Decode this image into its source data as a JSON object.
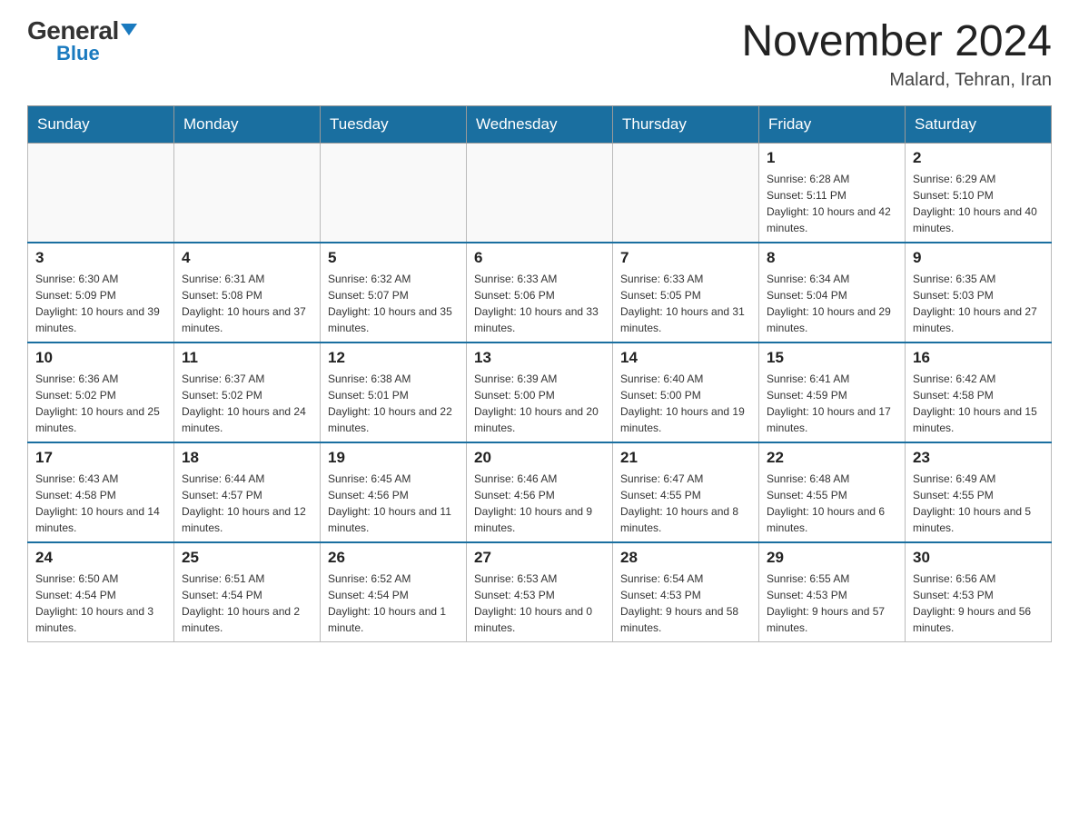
{
  "header": {
    "logo_general": "General",
    "logo_blue": "Blue",
    "month_title": "November 2024",
    "location": "Malard, Tehran, Iran"
  },
  "weekdays": [
    "Sunday",
    "Monday",
    "Tuesday",
    "Wednesday",
    "Thursday",
    "Friday",
    "Saturday"
  ],
  "weeks": [
    [
      {
        "day": "",
        "info": ""
      },
      {
        "day": "",
        "info": ""
      },
      {
        "day": "",
        "info": ""
      },
      {
        "day": "",
        "info": ""
      },
      {
        "day": "",
        "info": ""
      },
      {
        "day": "1",
        "info": "Sunrise: 6:28 AM\nSunset: 5:11 PM\nDaylight: 10 hours and 42 minutes."
      },
      {
        "day": "2",
        "info": "Sunrise: 6:29 AM\nSunset: 5:10 PM\nDaylight: 10 hours and 40 minutes."
      }
    ],
    [
      {
        "day": "3",
        "info": "Sunrise: 6:30 AM\nSunset: 5:09 PM\nDaylight: 10 hours and 39 minutes."
      },
      {
        "day": "4",
        "info": "Sunrise: 6:31 AM\nSunset: 5:08 PM\nDaylight: 10 hours and 37 minutes."
      },
      {
        "day": "5",
        "info": "Sunrise: 6:32 AM\nSunset: 5:07 PM\nDaylight: 10 hours and 35 minutes."
      },
      {
        "day": "6",
        "info": "Sunrise: 6:33 AM\nSunset: 5:06 PM\nDaylight: 10 hours and 33 minutes."
      },
      {
        "day": "7",
        "info": "Sunrise: 6:33 AM\nSunset: 5:05 PM\nDaylight: 10 hours and 31 minutes."
      },
      {
        "day": "8",
        "info": "Sunrise: 6:34 AM\nSunset: 5:04 PM\nDaylight: 10 hours and 29 minutes."
      },
      {
        "day": "9",
        "info": "Sunrise: 6:35 AM\nSunset: 5:03 PM\nDaylight: 10 hours and 27 minutes."
      }
    ],
    [
      {
        "day": "10",
        "info": "Sunrise: 6:36 AM\nSunset: 5:02 PM\nDaylight: 10 hours and 25 minutes."
      },
      {
        "day": "11",
        "info": "Sunrise: 6:37 AM\nSunset: 5:02 PM\nDaylight: 10 hours and 24 minutes."
      },
      {
        "day": "12",
        "info": "Sunrise: 6:38 AM\nSunset: 5:01 PM\nDaylight: 10 hours and 22 minutes."
      },
      {
        "day": "13",
        "info": "Sunrise: 6:39 AM\nSunset: 5:00 PM\nDaylight: 10 hours and 20 minutes."
      },
      {
        "day": "14",
        "info": "Sunrise: 6:40 AM\nSunset: 5:00 PM\nDaylight: 10 hours and 19 minutes."
      },
      {
        "day": "15",
        "info": "Sunrise: 6:41 AM\nSunset: 4:59 PM\nDaylight: 10 hours and 17 minutes."
      },
      {
        "day": "16",
        "info": "Sunrise: 6:42 AM\nSunset: 4:58 PM\nDaylight: 10 hours and 15 minutes."
      }
    ],
    [
      {
        "day": "17",
        "info": "Sunrise: 6:43 AM\nSunset: 4:58 PM\nDaylight: 10 hours and 14 minutes."
      },
      {
        "day": "18",
        "info": "Sunrise: 6:44 AM\nSunset: 4:57 PM\nDaylight: 10 hours and 12 minutes."
      },
      {
        "day": "19",
        "info": "Sunrise: 6:45 AM\nSunset: 4:56 PM\nDaylight: 10 hours and 11 minutes."
      },
      {
        "day": "20",
        "info": "Sunrise: 6:46 AM\nSunset: 4:56 PM\nDaylight: 10 hours and 9 minutes."
      },
      {
        "day": "21",
        "info": "Sunrise: 6:47 AM\nSunset: 4:55 PM\nDaylight: 10 hours and 8 minutes."
      },
      {
        "day": "22",
        "info": "Sunrise: 6:48 AM\nSunset: 4:55 PM\nDaylight: 10 hours and 6 minutes."
      },
      {
        "day": "23",
        "info": "Sunrise: 6:49 AM\nSunset: 4:55 PM\nDaylight: 10 hours and 5 minutes."
      }
    ],
    [
      {
        "day": "24",
        "info": "Sunrise: 6:50 AM\nSunset: 4:54 PM\nDaylight: 10 hours and 3 minutes."
      },
      {
        "day": "25",
        "info": "Sunrise: 6:51 AM\nSunset: 4:54 PM\nDaylight: 10 hours and 2 minutes."
      },
      {
        "day": "26",
        "info": "Sunrise: 6:52 AM\nSunset: 4:54 PM\nDaylight: 10 hours and 1 minute."
      },
      {
        "day": "27",
        "info": "Sunrise: 6:53 AM\nSunset: 4:53 PM\nDaylight: 10 hours and 0 minutes."
      },
      {
        "day": "28",
        "info": "Sunrise: 6:54 AM\nSunset: 4:53 PM\nDaylight: 9 hours and 58 minutes."
      },
      {
        "day": "29",
        "info": "Sunrise: 6:55 AM\nSunset: 4:53 PM\nDaylight: 9 hours and 57 minutes."
      },
      {
        "day": "30",
        "info": "Sunrise: 6:56 AM\nSunset: 4:53 PM\nDaylight: 9 hours and 56 minutes."
      }
    ]
  ]
}
